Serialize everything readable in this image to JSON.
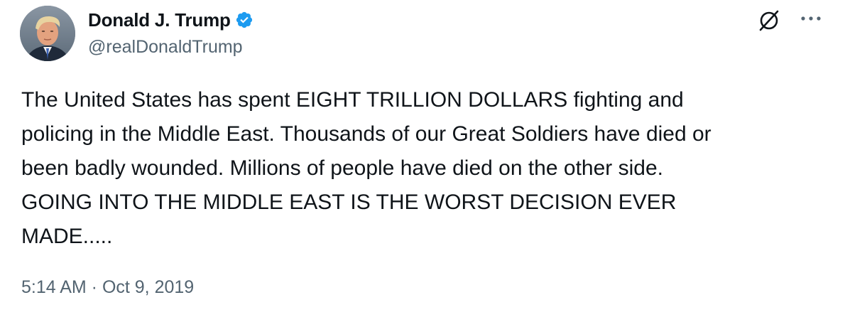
{
  "tweet": {
    "author": {
      "display_name": "Donald J. Trump",
      "handle": "@realDonaldTrump",
      "verified": true,
      "avatar_icon": "profile-photo"
    },
    "text": "The United States has spent EIGHT TRILLION DOLLARS fighting and\npolicing in the Middle East. Thousands of our Great Soldiers have died or\nbeen badly wounded. Millions of people have died on the other side.\nGOING INTO THE MIDDLE EAST IS THE WORST DECISION EVER\nMADE.....",
    "timestamp": "5:14 AM · Oct 9, 2019"
  },
  "header_actions": {
    "grok_icon": "grok-icon",
    "more_icon": "more-options-icon"
  },
  "colors": {
    "text_primary": "#0f1419",
    "text_secondary": "#536471",
    "verified_blue": "#1d9bf0",
    "background": "#ffffff"
  }
}
